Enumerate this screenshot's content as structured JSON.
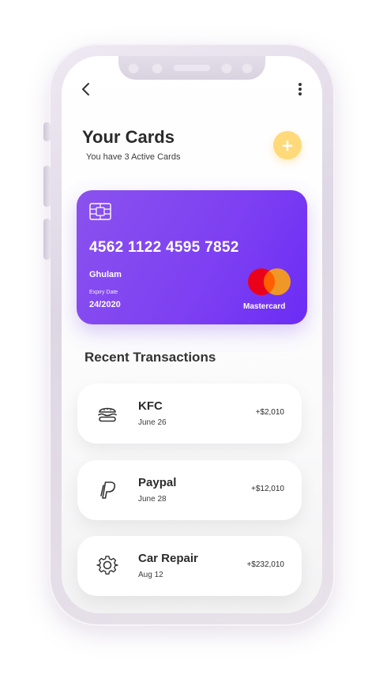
{
  "header": {
    "title": "Your Cards",
    "subtitle": "You have 3 Active Cards",
    "add_button_label": "+"
  },
  "card": {
    "number": "4562 1122 4595 7852",
    "holder_name": "Ghulam",
    "expiry_label": "Expiry Date",
    "expiry_value": "24/2020",
    "network": "Mastercard",
    "gradient_start": "#8a52ee",
    "gradient_end": "#6b2cf5"
  },
  "transactions_section": {
    "title": "Recent Transactions",
    "items": [
      {
        "name": "KFC",
        "date": "June 26",
        "amount": "+$2,010",
        "icon": "burger-icon"
      },
      {
        "name": "Paypal",
        "date": "June 28",
        "amount": "+$12,010",
        "icon": "paypal-icon"
      },
      {
        "name": "Car Repair",
        "date": "Aug 12",
        "amount": "+$232,010",
        "icon": "gear-icon"
      }
    ]
  },
  "colors": {
    "accent_yellow": "#ffd97a",
    "mastercard_red": "#eb001b",
    "mastercard_orange": "#f79e1b"
  }
}
